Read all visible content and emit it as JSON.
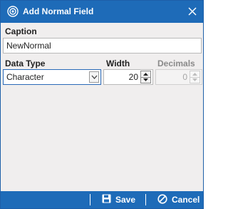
{
  "dialog": {
    "title": "Add Normal Field",
    "app_icon": "gear-icon",
    "close_icon": "close-icon"
  },
  "form": {
    "caption_label": "Caption",
    "caption_value": "NewNormal",
    "data_type_label": "Data Type",
    "data_type_value": "Character",
    "width_label": "Width",
    "width_value": "20",
    "decimals_label": "Decimals",
    "decimals_value": "0"
  },
  "footer": {
    "save_label": "Save",
    "save_icon": "floppy-disk-icon",
    "cancel_label": "Cancel",
    "cancel_icon": "cancel-circle-icon"
  },
  "colors": {
    "accent": "#1e6bb8",
    "background": "#f0eeee"
  }
}
